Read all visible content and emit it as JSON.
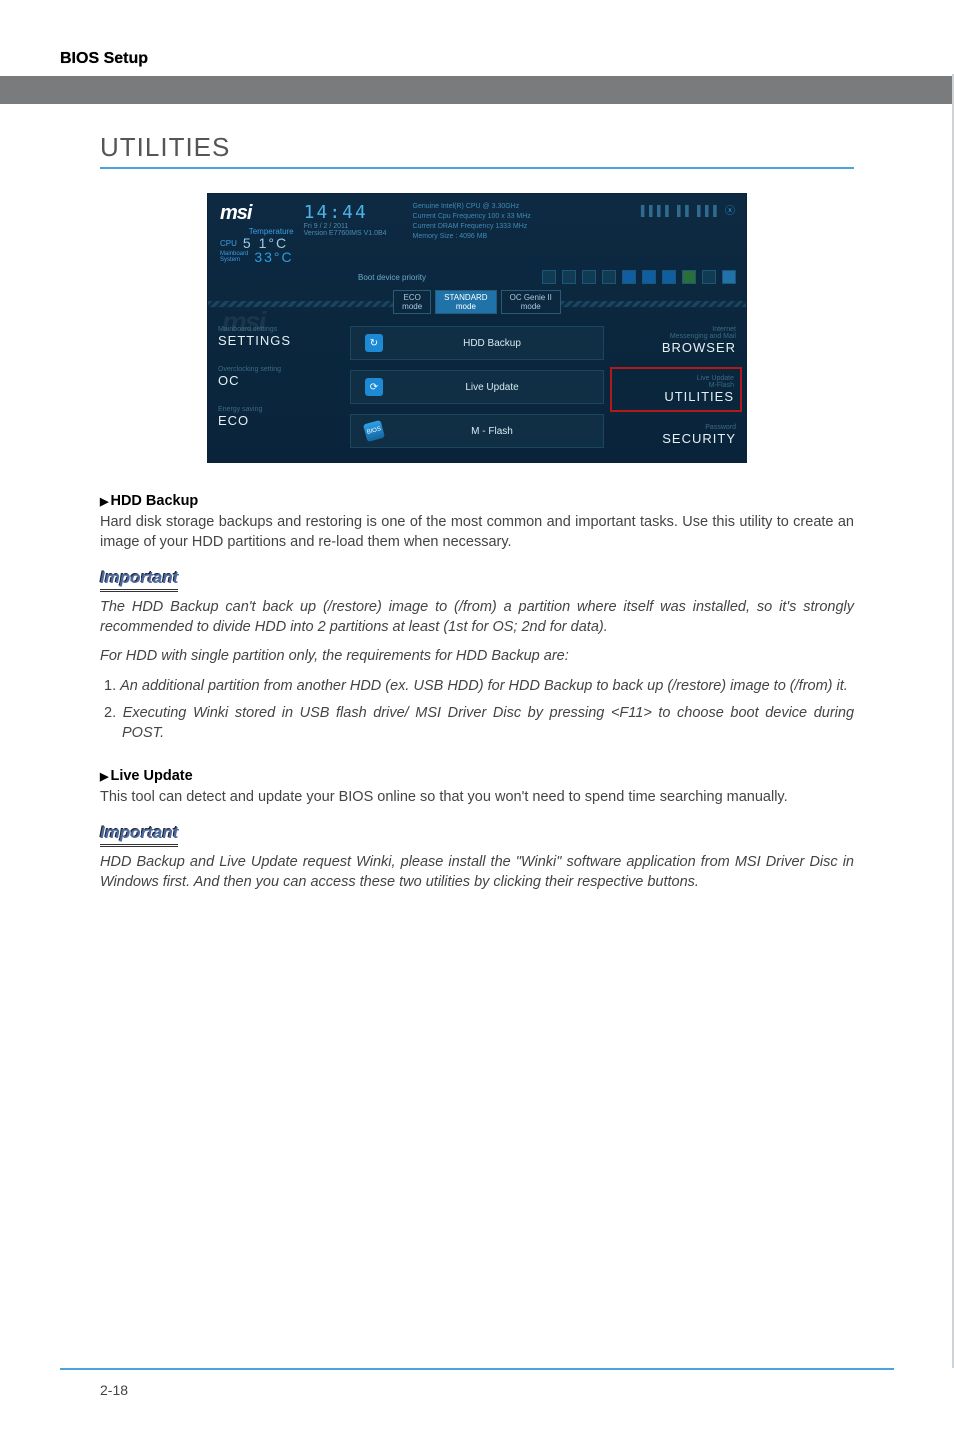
{
  "header": {
    "title": "BIOS Setup"
  },
  "heading": "UTILITIES",
  "bios": {
    "logo": "msi",
    "temp_label": "Temperature",
    "cpu_label": "CPU",
    "cpu_temp": "5 1°C",
    "sys_label": "Mainboard\nSystem",
    "sys_temp": "33°C",
    "clock": "14:44",
    "date": "Fri  9 / 2 / 2011",
    "version": "Version E7760IMS V1.0B4",
    "cpu_info1": "Genuine Intel(R) CPU @ 3.30GHz",
    "cpu_info2": "Current Cpu Frequency 100 x 33 MHz",
    "cpu_info3": "Current DRAM Frequency 1333 MHz",
    "cpu_info4": "Memory Size : 4096 MB",
    "boot_label": "Boot device priority",
    "modes": {
      "eco": "ECO\nmode",
      "standard": "STANDARD\nmode",
      "ocgenie": "OC Genie II\nmode"
    },
    "left": {
      "settings_sub": "Mainboard settings",
      "settings": "SETTINGS",
      "oc_sub": "Overclocking setting",
      "oc": "OC",
      "eco_sub": "Energy saving",
      "eco": "ECO"
    },
    "center": {
      "hdd": "HDD Backup",
      "live": "Live Update",
      "mflash": "M - Flash"
    },
    "right": {
      "browser_sub": "Internet\nMessenging and Mail",
      "browser": "BROWSER",
      "util_sub": "Live Update\nM-Flash",
      "util": "UTILITIES",
      "sec_sub": "Password",
      "sec": "SECURITY"
    }
  },
  "sections": {
    "hdd_head": "HDD Backup",
    "hdd_body": "Hard disk storage backups and restoring is one of the most common and important tasks. Use this utility to create an image of your HDD partitions and re-load them when necessary.",
    "important_label": "Important",
    "imp1_p1": "The HDD Backup can't back up (/restore) image to (/from) a partition where itself was installed, so it's strongly recommended to divide HDD into 2 partitions at least (1st for OS; 2nd for data).",
    "imp1_p2": "For HDD with single partition only, the requirements for HDD Backup are:",
    "imp1_li1_num": "1. ",
    "imp1_li1": "An additional partition from another HDD (ex. USB HDD) for HDD Backup to back up (/restore) image to (/from) it.",
    "imp1_li2_num": "2. ",
    "imp1_li2": "Executing Winki stored in USB flash drive/ MSI Driver Disc by pressing <F11> to choose boot device during POST.",
    "live_head": "Live Update",
    "live_body": "This tool can detect and update your BIOS online so that you won't need to spend time searching manually.",
    "imp2_p1": "HDD Backup and Live Update request Winki, please install the \"Winki\" software application from MSI Driver Disc in Windows first. And then you can access these two utilities by clicking their respective buttons."
  },
  "footer": {
    "page": "2-18"
  }
}
